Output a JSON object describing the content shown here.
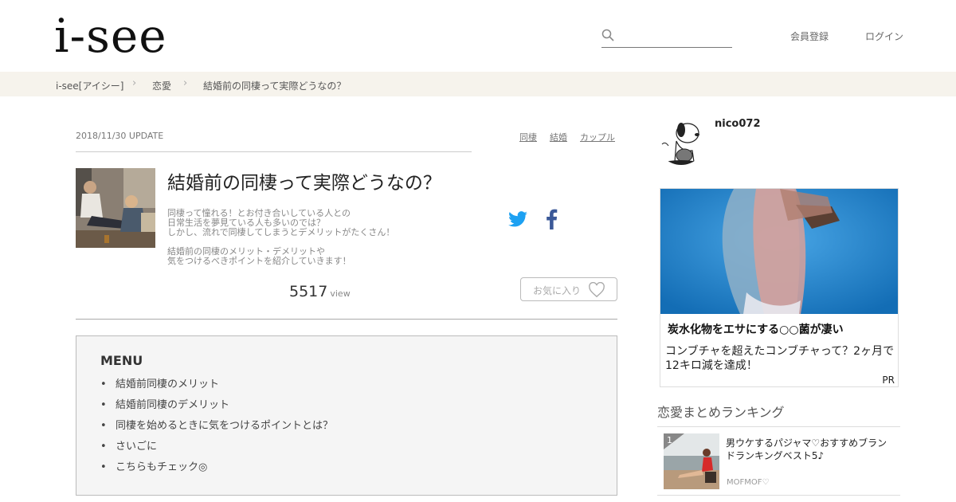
{
  "header": {
    "logo": "i-see",
    "search_placeholder": "",
    "register": "会員登録",
    "login": "ログイン"
  },
  "breadcrumb": [
    "i-see[アイシー]",
    "恋愛",
    "結婚前の同棲って実際どうなの？"
  ],
  "article": {
    "update": "2018/11/30 UPDATE",
    "tags": [
      "同棲",
      "結婚",
      "カップル"
    ],
    "title": "結婚前の同棲って実際どうなの？",
    "desc": [
      "同棲って憧れる！とお付き合いしている人との",
      "日常生活を夢見ている人も多いのでは？",
      "しかし、流れで同棲してしまうとデメリットがたくさん！",
      "結婚前の同棲のメリット・デメリットや",
      "気をつけるべきポイントを紹介していきます！"
    ],
    "views": "5517",
    "views_unit": "view",
    "favorite": "お気に入り"
  },
  "menu": {
    "title": "MENU",
    "items": [
      "結婚前同棲のメリット",
      "結婚前同棲のデメリット",
      "同棲を始めるときに気をつけるポイントとは？",
      "さいごに",
      "こちらもチェック◎"
    ]
  },
  "sidebar": {
    "username": "nico072",
    "ad": {
      "title": "炭水化物をエサにする○○菌が凄い",
      "text": "コンブチャを超えたコンブチャって？2ヶ月で12キロ減を達成！",
      "pr": "PR"
    },
    "ranking": {
      "title": "恋愛まとめランキング",
      "items": [
        {
          "rank": "1",
          "title": "男ウケするパジャマ♡おすすめブランドランキングベスト5♪",
          "source": "MOFMOF♡"
        }
      ]
    }
  },
  "colors": {
    "breadcrumb_bg": "#f6f3ec",
    "twitter": "#1da1f2",
    "facebook": "#3b5998",
    "ad_bg": "#1e7fc8"
  }
}
